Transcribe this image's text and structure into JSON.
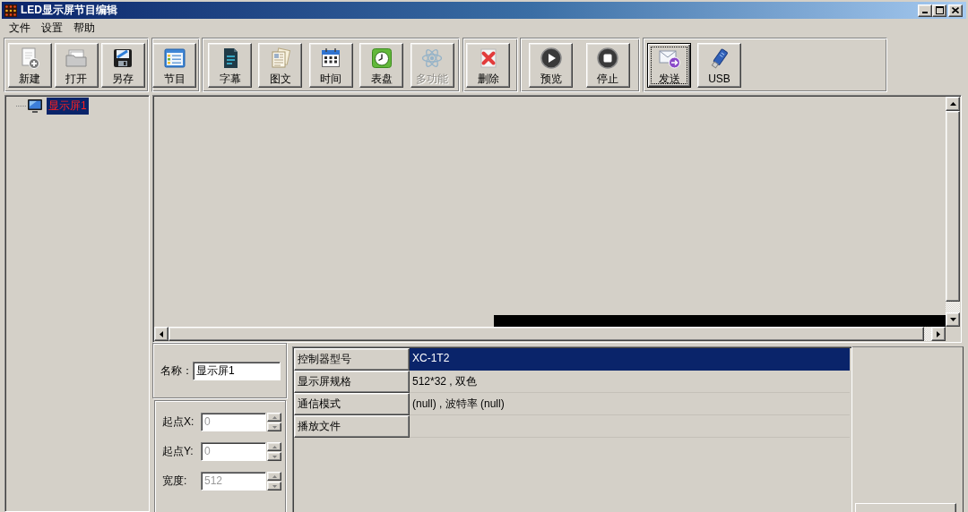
{
  "window": {
    "title": "LED显示屏节目编辑"
  },
  "menu": [
    {
      "label": "文件"
    },
    {
      "label": "设置"
    },
    {
      "label": "帮助"
    }
  ],
  "toolbar": [
    {
      "buttons": [
        {
          "label": "新建",
          "disabled": false,
          "focused": false
        },
        {
          "label": "打开",
          "disabled": false,
          "focused": false
        },
        {
          "label": "另存",
          "disabled": false,
          "focused": false
        }
      ]
    },
    {
      "buttons": [
        {
          "label": "节目",
          "disabled": false,
          "focused": false
        }
      ]
    },
    {
      "buttons": [
        {
          "label": "字幕",
          "disabled": false,
          "focused": false
        },
        {
          "label": "图文",
          "disabled": false,
          "focused": false
        },
        {
          "label": "时间",
          "disabled": false,
          "focused": false
        },
        {
          "label": "表盘",
          "disabled": false,
          "focused": false
        },
        {
          "label": "多功能",
          "disabled": true,
          "focused": false
        }
      ]
    },
    {
      "buttons": [
        {
          "label": "删除",
          "disabled": false,
          "focused": false
        }
      ]
    },
    {
      "buttons": [
        {
          "label": "预览",
          "disabled": false,
          "focused": false
        },
        {
          "label": "停止",
          "disabled": false,
          "focused": false
        }
      ]
    },
    {
      "buttons": [
        {
          "label": "发送",
          "disabled": false,
          "focused": true
        },
        {
          "label": "USB",
          "disabled": false,
          "focused": false
        }
      ]
    }
  ],
  "tree": [
    {
      "label": "显示屏1",
      "selected": true
    }
  ],
  "screen_settings": {
    "name": {
      "label": "名称：",
      "value": "显示屏1"
    },
    "geometry": [
      {
        "label": "起点X:",
        "value": "0",
        "disabled": true
      },
      {
        "label": "起点Y:",
        "value": "0",
        "disabled": true
      },
      {
        "label": "宽度:",
        "value": "512",
        "disabled": true
      }
    ]
  },
  "properties": [
    {
      "name": "控制器型号",
      "value": "XC-1T2",
      "selected": true
    },
    {
      "name": "显示屏规格",
      "value": "512*32 , 双色",
      "selected": false
    },
    {
      "name": "通信模式",
      "value": "(null) , 波特率 (null)",
      "selected": false
    },
    {
      "name": "播放文件",
      "selected": false
    }
  ]
}
